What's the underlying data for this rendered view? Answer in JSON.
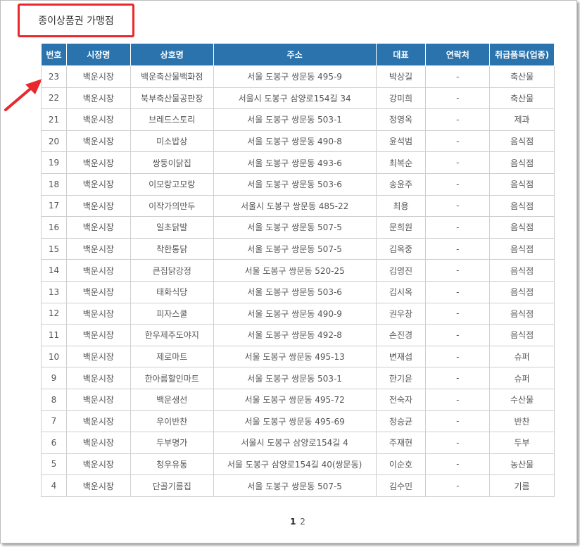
{
  "title": "종이상품권 가맹점",
  "columns": [
    "번호",
    "시장명",
    "상호명",
    "주소",
    "대표",
    "연락처",
    "취급품목(업종)"
  ],
  "rows": [
    [
      "23",
      "백운시장",
      "백운축산물백화점",
      "서울 도봉구 쌍문동 495-9",
      "박상길",
      "-",
      "축산물"
    ],
    [
      "22",
      "백운시장",
      "북부축산물공판장",
      "서울시 도봉구 삼양로154길 34",
      "강미희",
      "-",
      "축산물"
    ],
    [
      "21",
      "백운시장",
      "브레드스토리",
      "서울 도봉구 쌍문동 503-1",
      "정영옥",
      "-",
      "제과"
    ],
    [
      "20",
      "백운시장",
      "미소밥상",
      "서울 도봉구 쌍문동 490-8",
      "윤석범",
      "-",
      "음식점"
    ],
    [
      "19",
      "백운시장",
      "쌍둥이닭집",
      "서울 도봉구 쌍문동 493-6",
      "최복순",
      "-",
      "음식점"
    ],
    [
      "18",
      "백운시장",
      "이모랑고모랑",
      "서울 도봉구 쌍문동 503-6",
      "송윤주",
      "-",
      "음식점"
    ],
    [
      "17",
      "백운시장",
      "이작가의만두",
      "서울시 도봉구 쌍문동 485-22",
      "최용",
      "-",
      "음식점"
    ],
    [
      "16",
      "백운시장",
      "일초닭발",
      "서울 도봉구 쌍문동 507-5",
      "문희원",
      "-",
      "음식점"
    ],
    [
      "15",
      "백운시장",
      "착한통닭",
      "서울 도봉구 쌍문동 507-5",
      "김옥중",
      "-",
      "음식점"
    ],
    [
      "14",
      "백운시장",
      "큰집닭강정",
      "서울 도봉구 쌍문동 520-25",
      "김영진",
      "-",
      "음식점"
    ],
    [
      "13",
      "백운시장",
      "태화식당",
      "서울 도봉구 쌍문동 503-6",
      "김시옥",
      "-",
      "음식점"
    ],
    [
      "12",
      "백운시장",
      "피자스쿨",
      "서울 도봉구 쌍문동 490-9",
      "권우창",
      "-",
      "음식점"
    ],
    [
      "11",
      "백운시장",
      "한우제주도야지",
      "서울 도봉구 쌍문동 492-8",
      "손진경",
      "-",
      "음식점"
    ],
    [
      "10",
      "백운시장",
      "제로마트",
      "서울 도봉구 쌍문동 495-13",
      "변재섭",
      "-",
      "슈퍼"
    ],
    [
      "9",
      "백운시장",
      "한아름할인마트",
      "서울 도봉구 쌍문동 503-1",
      "한기윤",
      "-",
      "슈퍼"
    ],
    [
      "8",
      "백운시장",
      "백운생선",
      "서울 도봉구 쌍문동 495-72",
      "전숙자",
      "-",
      "수산물"
    ],
    [
      "7",
      "백운시장",
      "우이반찬",
      "서울 도봉구 쌍문동 495-69",
      "정승균",
      "-",
      "반찬"
    ],
    [
      "6",
      "백운시장",
      "두부명가",
      "서울시 도봉구 삼양로154길 4",
      "주재현",
      "-",
      "두부"
    ],
    [
      "5",
      "백운시장",
      "청우유통",
      "서울 도봉구 삼양로154길 40(쌍문동)",
      "이순호",
      "-",
      "농산물"
    ],
    [
      "4",
      "백운시장",
      "단골기름집",
      "서울 도봉구 쌍문동 507-5",
      "김수민",
      "-",
      "기름"
    ]
  ],
  "pagination": {
    "current": "1",
    "pages": [
      "1",
      "2"
    ]
  },
  "colors": {
    "header_bg": "#2a73ad",
    "highlight": "#e8282b"
  },
  "icons": {
    "annotation": "red-arrow-icon"
  }
}
